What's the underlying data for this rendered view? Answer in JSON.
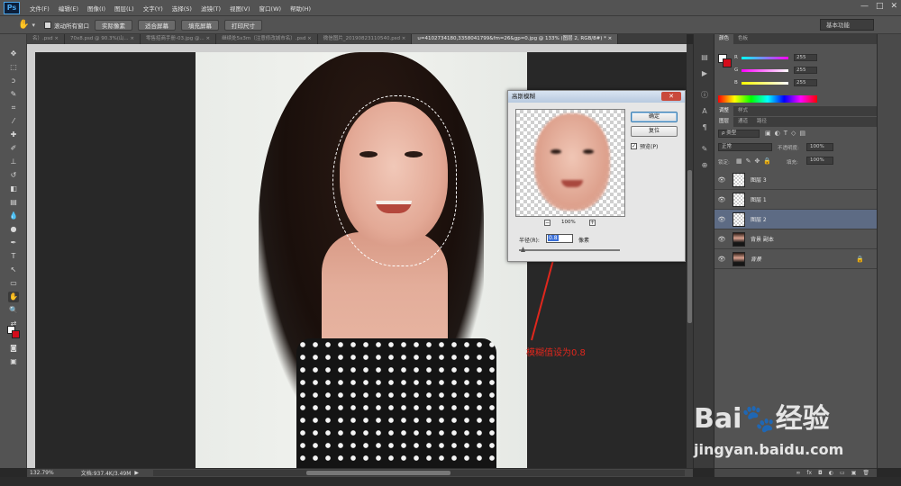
{
  "app": {
    "logo": "Ps",
    "menu": [
      "文件(F)",
      "编辑(E)",
      "图像(I)",
      "图层(L)",
      "文字(Y)",
      "选择(S)",
      "滤镜(T)",
      "视图(V)",
      "窗口(W)",
      "帮助(H)"
    ],
    "window_controls": [
      "—",
      "□",
      "✕"
    ]
  },
  "options_bar": {
    "scroll_all_label": "滚动所有窗口",
    "buttons": [
      "实际像素",
      "适合屏幕",
      "填充屏幕",
      "打印尺寸"
    ],
    "workspace": "基本功能"
  },
  "tabs": [
    "名）.psd ×",
    "70x8.psd @ 90.3%(山... ×",
    "零售招商手册-03.jpg @... ×",
    "继续处5x3m（注意修改城市名）.psd ×",
    "微信图片_20190823110540.psd ×",
    "u=4102734180,3358041799&fm=26&gp=0.jpg @ 133% (图层 2, RGB/8#) * ×"
  ],
  "dialog": {
    "title": "高斯模糊",
    "close": "✕",
    "ok": "确定",
    "reset": "复位",
    "preview_label": "预览(P)",
    "preview_checked": "✓",
    "zoom": "100%",
    "zoom_out": "−",
    "zoom_in": "+",
    "radius_label": "半径(R):",
    "radius_value": "0.8",
    "radius_unit": "像素"
  },
  "annotation": {
    "text": "模糊值设为0.8",
    "color": "#e0271d"
  },
  "color_panel": {
    "tabs": [
      "颜色",
      "色板"
    ],
    "rows": [
      {
        "label": "R",
        "value": "255"
      },
      {
        "label": "G",
        "value": "255"
      },
      {
        "label": "B",
        "value": "255"
      }
    ]
  },
  "adjust_panel": {
    "tabs": [
      "调整",
      "样式"
    ]
  },
  "layers_panel": {
    "tabs": [
      "图层",
      "通道",
      "路径"
    ],
    "kind_label": "ρ 类型",
    "blend_mode": "正常",
    "opacity_label": "不透明度:",
    "opacity_value": "100%",
    "lock_label": "锁定:",
    "fill_label": "填充:",
    "fill_value": "100%",
    "layers": [
      {
        "name": "图层 3",
        "selected": false
      },
      {
        "name": "图层 1",
        "selected": false
      },
      {
        "name": "图层 2",
        "selected": true
      },
      {
        "name": "背景 副本",
        "selected": false
      },
      {
        "name": "背景",
        "selected": false
      }
    ],
    "bottom_icons": [
      "∞",
      "fx",
      "◘",
      "◐",
      "▭",
      "▣",
      "🗑"
    ]
  },
  "status": {
    "zoom": "132.79%",
    "doc_info": "文档:937.4K/3.49M"
  },
  "watermark": {
    "logo": "Bai🐾经验",
    "url": "jingyan.baidu.com"
  }
}
